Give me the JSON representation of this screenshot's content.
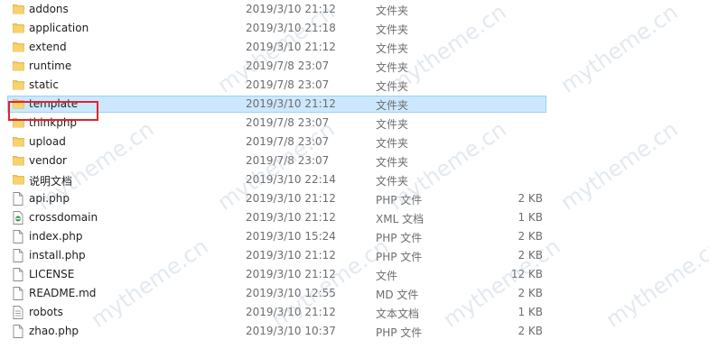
{
  "files": [
    {
      "name": "addons",
      "date": "2019/3/10 21:12",
      "type": "文件夹",
      "size": "",
      "icon": "folder-icon"
    },
    {
      "name": "application",
      "date": "2019/3/10 21:18",
      "type": "文件夹",
      "size": "",
      "icon": "folder-icon"
    },
    {
      "name": "extend",
      "date": "2019/3/10 21:12",
      "type": "文件夹",
      "size": "",
      "icon": "folder-icon"
    },
    {
      "name": "runtime",
      "date": "2019/7/8 23:07",
      "type": "文件夹",
      "size": "",
      "icon": "folder-icon"
    },
    {
      "name": "static",
      "date": "2019/7/8 23:07",
      "type": "文件夹",
      "size": "",
      "icon": "folder-icon"
    },
    {
      "name": "template",
      "date": "2019/3/10 21:12",
      "type": "文件夹",
      "size": "",
      "icon": "folder-icon",
      "selected": true
    },
    {
      "name": "thinkphp",
      "date": "2019/7/8 23:07",
      "type": "文件夹",
      "size": "",
      "icon": "folder-icon"
    },
    {
      "name": "upload",
      "date": "2019/7/8 23:07",
      "type": "文件夹",
      "size": "",
      "icon": "folder-icon"
    },
    {
      "name": "vendor",
      "date": "2019/7/8 23:07",
      "type": "文件夹",
      "size": "",
      "icon": "folder-icon"
    },
    {
      "name": "说明文档",
      "date": "2019/3/10 22:14",
      "type": "文件夹",
      "size": "",
      "icon": "folder-icon"
    },
    {
      "name": "api.php",
      "date": "2019/3/10 21:12",
      "type": "PHP 文件",
      "size": "2 KB",
      "icon": "document-icon"
    },
    {
      "name": "crossdomain",
      "date": "2019/3/10 21:12",
      "type": "XML 文档",
      "size": "1 KB",
      "icon": "xml-document-icon"
    },
    {
      "name": "index.php",
      "date": "2019/3/10 15:24",
      "type": "PHP 文件",
      "size": "2 KB",
      "icon": "document-icon"
    },
    {
      "name": "install.php",
      "date": "2019/3/10 21:12",
      "type": "PHP 文件",
      "size": "2 KB",
      "icon": "document-icon"
    },
    {
      "name": "LICENSE",
      "date": "2019/3/10 21:12",
      "type": "文件",
      "size": "12 KB",
      "icon": "document-icon"
    },
    {
      "name": "README.md",
      "date": "2019/3/10 12:55",
      "type": "MD 文件",
      "size": "2 KB",
      "icon": "document-icon"
    },
    {
      "name": "robots",
      "date": "2019/3/10 21:12",
      "type": "文本文档",
      "size": "1 KB",
      "icon": "text-document-icon"
    },
    {
      "name": "zhao.php",
      "date": "2019/3/10 10:37",
      "type": "PHP 文件",
      "size": "2 KB",
      "icon": "document-icon"
    }
  ],
  "watermark_text": "mytheme.cn",
  "colors": {
    "selection_bg": "#cce8ff",
    "selection_border": "#99d1ff",
    "highlight_box": "#e0242b",
    "folder": "#f4c95d"
  }
}
